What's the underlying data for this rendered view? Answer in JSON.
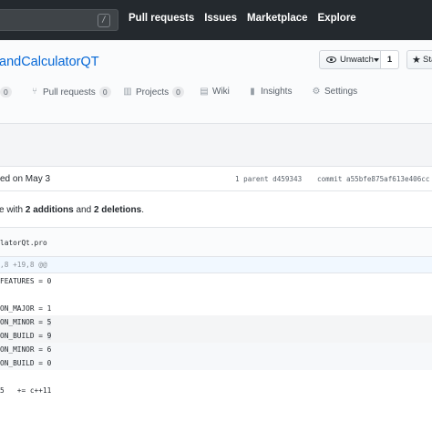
{
  "nav": {
    "search_shortcut": "/",
    "links": [
      "Pull requests",
      "Issues",
      "Marketplace",
      "Explore"
    ]
  },
  "repo": {
    "name": "andCalculatorQT",
    "watch_label": "Unwatch",
    "watch_count": "1",
    "star_label": "Sta"
  },
  "tabs": {
    "issues_count": "0",
    "pull_requests_label": "Pull requests",
    "pull_requests_count": "0",
    "projects_label": "Projects",
    "projects_count": "0",
    "wiki_label": "Wiki",
    "insights_label": "Insights",
    "settings_label": "Settings"
  },
  "commit": {
    "authored": "ed on May 3",
    "parent": "1 parent d459343",
    "sha": "commit a55bfe875af613e406cc"
  },
  "summary": {
    "prefix": "e with ",
    "additions": "2 additions",
    "middle": " and ",
    "deletions": "2 deletions",
    "suffix": "."
  },
  "file": {
    "name": "latorQt.pro",
    "hunk": ",8 +19,8 @@"
  },
  "diff_lines": {
    "l1": "FEATURES = 0",
    "l2": "",
    "l3": "ON_MAJOR = 1",
    "l4_prefix": "ON_MINOR = ",
    "l4_val": "5",
    "l5_prefix": "ON_BUILD = ",
    "l5_val": "9",
    "l6": "ON_MINOR = 6",
    "l7": "ON_BUILD = 0",
    "l8": "",
    "l9": "5   += c++11"
  },
  "colors": {
    "topbar": "#24292e",
    "link": "#0366d6",
    "commit_bg": "#f1f8ff"
  }
}
